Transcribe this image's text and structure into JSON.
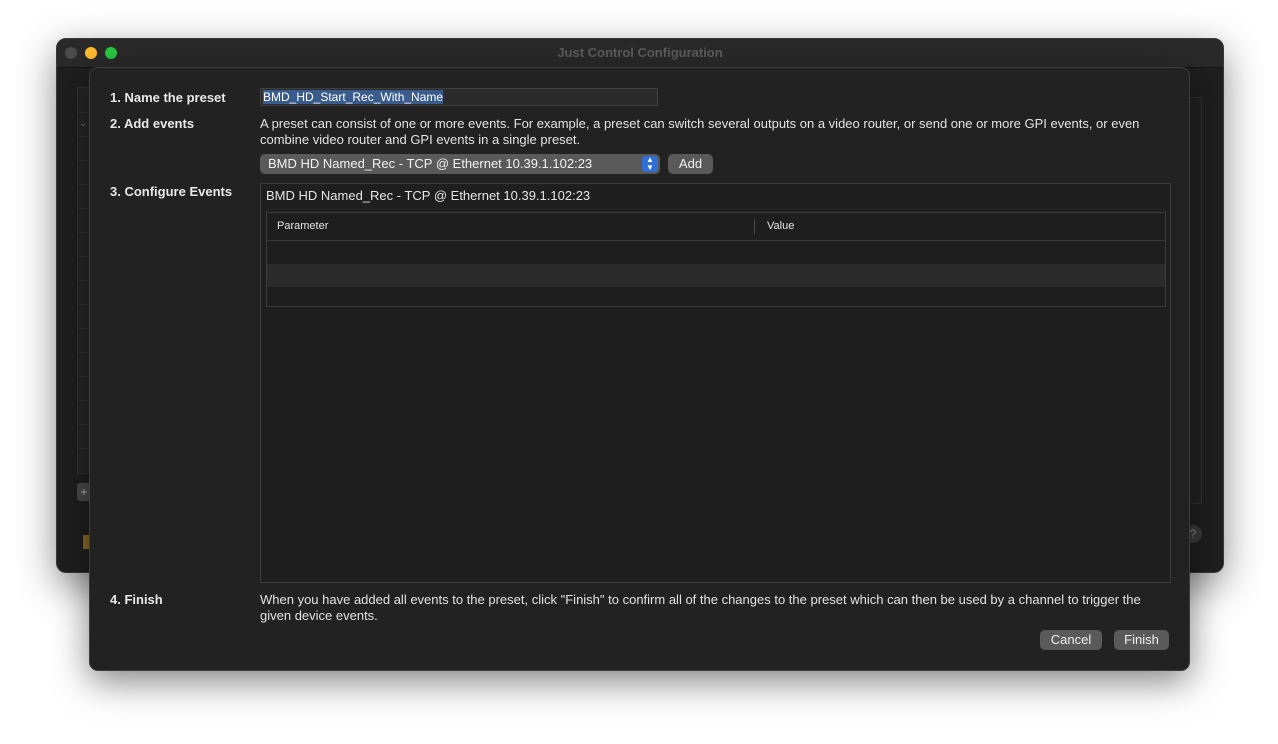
{
  "window": {
    "title": "Just Control Configuration"
  },
  "background": {
    "plus_label": "+",
    "help_label": "?"
  },
  "sheet": {
    "step1_label": "1. Name the preset",
    "preset_name": "BMD_HD_Start_Rec_With_Name",
    "step2_label": "2. Add events",
    "step2_description": "A preset can consist of one or more events. For example, a preset can switch several outputs on a video router, or send one or more GPI events, or even combine video router and GPI events in a single preset.",
    "event_select_value": "BMD HD Named_Rec - TCP @ Ethernet 10.39.1.102:23",
    "add_label": "Add",
    "step3_label": "3. Configure Events",
    "event_title": "BMD HD Named_Rec - TCP @ Ethernet 10.39.1.102:23",
    "table": {
      "columns": [
        "Parameter",
        "Value"
      ],
      "rows": [
        [
          "",
          ""
        ],
        [
          "",
          ""
        ],
        [
          "",
          ""
        ]
      ]
    },
    "step4_label": "4. Finish",
    "step4_description": "When you have added all events to the preset, click \"Finish\" to confirm all of the changes to the preset which can then be used by a channel to trigger the given device events.",
    "cancel_label": "Cancel",
    "finish_label": "Finish"
  }
}
